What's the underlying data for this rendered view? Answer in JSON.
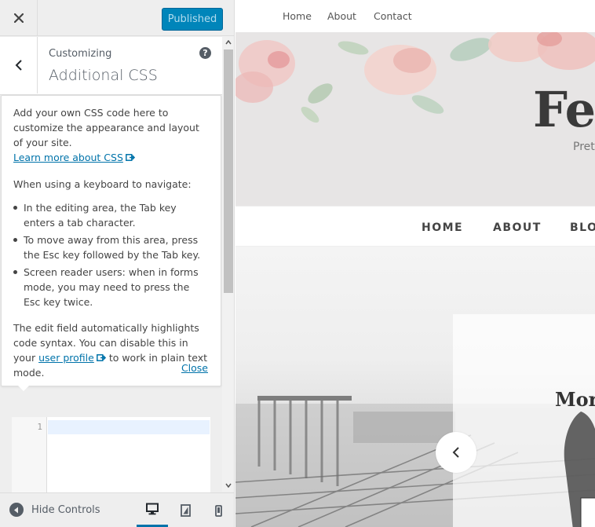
{
  "header": {
    "publish_label": "Published"
  },
  "panel": {
    "customizing_label": "Customizing",
    "title": "Additional CSS",
    "help_symbol": "?"
  },
  "help": {
    "intro": "Add your own CSS code here to customize the appearance and layout of your site.",
    "learn_more_link": "Learn more about CSS",
    "keyboard_heading": "When using a keyboard to navigate:",
    "bullets": [
      "In the editing area, the Tab key enters a tab character.",
      "To move away from this area, press the Esc key followed by the Tab key.",
      "Screen reader users: when in forms mode, you may need to press the Esc key twice."
    ],
    "highlight_text_before": "The edit field automatically highlights code syntax. You can disable this in your",
    "user_profile_link": "user profile",
    "highlight_text_after": "to work in plain text mode.",
    "close_link": "Close"
  },
  "editor": {
    "line_number": "1"
  },
  "footer": {
    "hide_controls_label": "Hide Controls"
  },
  "preview": {
    "top_nav": [
      "Home",
      "About",
      "Contact"
    ],
    "site_title": "Fer",
    "site_tagline": "Pret",
    "main_nav": [
      "HOME",
      "ABOUT",
      "BLO"
    ],
    "slide_title": "Mor"
  },
  "colors": {
    "primary_button": "#0085ba",
    "link": "#0073aa",
    "sidebar_bg": "#eeeeee",
    "text": "#555d66"
  }
}
